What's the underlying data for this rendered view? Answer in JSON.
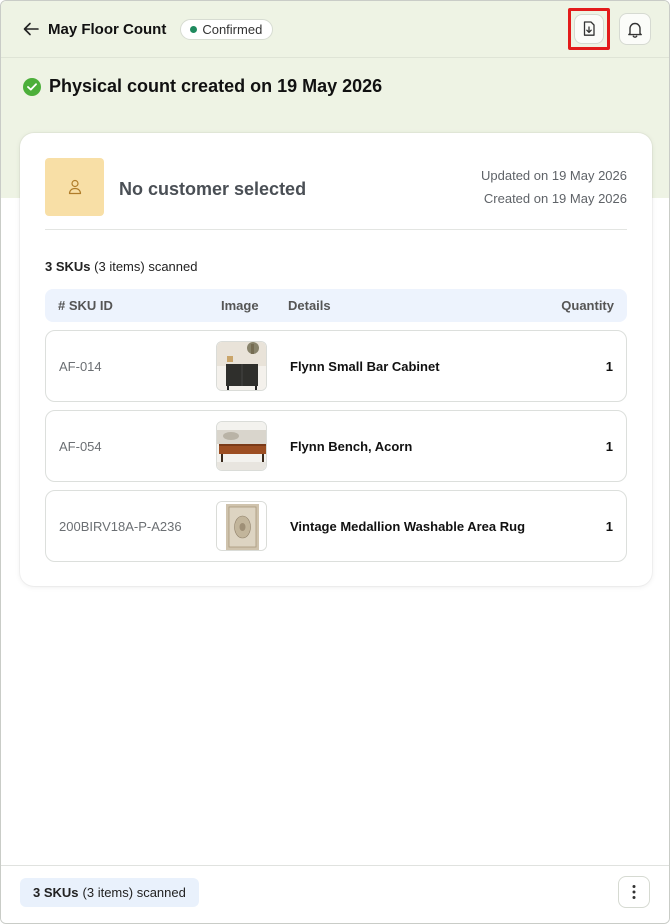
{
  "header": {
    "title": "May Floor Count",
    "status": "Confirmed",
    "status_color": "#1f8a5e",
    "icons": [
      "arrow-left-icon",
      "download-file-icon",
      "bell-icon"
    ]
  },
  "banner": {
    "text": "Physical count created on 19 May 2026",
    "icon": "check-circle-icon"
  },
  "customer": {
    "name": "No customer selected",
    "updated": "Updated on 19 May 2026",
    "created": "Created on 19 May 2026"
  },
  "summary": {
    "skus": "3 SKUs",
    "items": "(3 items) scanned"
  },
  "table": {
    "headers": {
      "sku": "# SKU ID",
      "image": "Image",
      "details": "Details",
      "quantity": "Quantity"
    },
    "rows": [
      {
        "sku": "AF-014",
        "details": "Flynn Small Bar Cabinet",
        "quantity": "1"
      },
      {
        "sku": "AF-054",
        "details": "Flynn Bench, Acorn",
        "quantity": "1"
      },
      {
        "sku": "200BIRV18A-P-A236",
        "details": "Vintage Medallion Washable Area Rug",
        "quantity": "1"
      }
    ]
  },
  "footer": {
    "skus": "3 SKUs",
    "items": "(3 items) scanned"
  },
  "colors": {
    "accent_green": "#4caf3a",
    "band": "#eef3e4",
    "avatar_bg": "#f8dfa6",
    "table_header_bg": "#edf3fd",
    "highlight": "#e31b1b"
  }
}
